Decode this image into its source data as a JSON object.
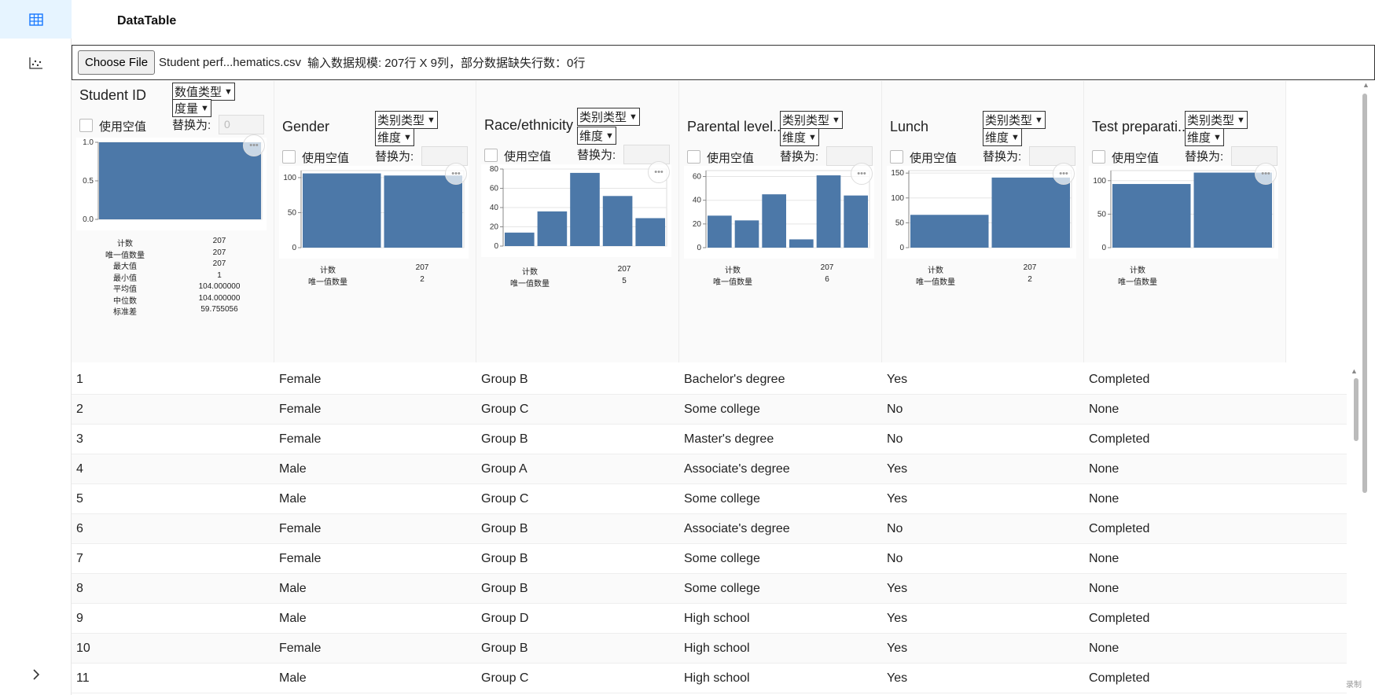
{
  "app": {
    "title": "DataTable"
  },
  "nav": {
    "items": [
      {
        "icon": "table-icon"
      },
      {
        "icon": "scatter-chart-icon"
      }
    ],
    "expand_icon": "chevron-right-icon"
  },
  "upload": {
    "button_label": "Choose File",
    "file_name": "Student perf...hematics.csv",
    "scale_text": "输入数据规模: 207行 X 9列，部分数据缺失行数：0行"
  },
  "columns": [
    {
      "name": "Student ID",
      "type_select": "数值类型",
      "role_select": "度量",
      "use_null_label": "使用空值",
      "replace_label": "替换为:",
      "replace_placeholder": "0",
      "stats": [
        [
          "计数",
          "207"
        ],
        [
          "唯一值数量",
          "207"
        ],
        [
          "最大值",
          "207"
        ],
        [
          "最小值",
          "1"
        ],
        [
          "平均值",
          "104.000000"
        ],
        [
          "中位数",
          "104.000000"
        ],
        [
          "标准差",
          "59.755056"
        ]
      ]
    },
    {
      "name": "Gender",
      "type_select": "类别类型",
      "role_select": "维度",
      "use_null_label": "使用空值",
      "replace_label": "替换为:",
      "replace_placeholder": "",
      "stats": [
        [
          "计数",
          "207"
        ],
        [
          "唯一值数量",
          "2"
        ]
      ]
    },
    {
      "name": "Race/ethnicity",
      "type_select": "类别类型",
      "role_select": "维度",
      "use_null_label": "使用空值",
      "replace_label": "替换为:",
      "replace_placeholder": "",
      "stats": [
        [
          "计数",
          "207"
        ],
        [
          "唯一值数量",
          "5"
        ]
      ]
    },
    {
      "name": "Parental level...",
      "type_select": "类别类型",
      "role_select": "维度",
      "use_null_label": "使用空值",
      "replace_label": "替换为:",
      "replace_placeholder": "",
      "stats": [
        [
          "计数",
          "207"
        ],
        [
          "唯一值数量",
          "6"
        ]
      ]
    },
    {
      "name": "Lunch",
      "type_select": "类别类型",
      "role_select": "维度",
      "use_null_label": "使用空值",
      "replace_label": "替换为:",
      "replace_placeholder": "",
      "stats": [
        [
          "计数",
          "207"
        ],
        [
          "唯一值数量",
          "2"
        ]
      ]
    },
    {
      "name": "Test preparati...",
      "type_select": "类别类型",
      "role_select": "维度",
      "use_null_label": "使用空值",
      "replace_label": "替换为:",
      "replace_placeholder": "",
      "stats": [
        [
          "计数",
          ""
        ],
        [
          "唯一值数量",
          ""
        ]
      ]
    }
  ],
  "chart_data": [
    {
      "type": "area",
      "yticks": [
        "1.0",
        "0.5",
        "0.0"
      ],
      "ylim": [
        0,
        1
      ],
      "values": [
        1,
        1
      ]
    },
    {
      "type": "bar",
      "yticks": [
        "100",
        "50",
        "0"
      ],
      "ylim": [
        0,
        110
      ],
      "values": [
        106,
        103
      ]
    },
    {
      "type": "bar",
      "yticks": [
        "80",
        "60",
        "40",
        "20",
        "0"
      ],
      "ylim": [
        0,
        80
      ],
      "values": [
        14,
        36,
        76,
        52,
        29
      ]
    },
    {
      "type": "bar",
      "yticks": [
        "60",
        "40",
        "20",
        "0"
      ],
      "ylim": [
        0,
        65
      ],
      "values": [
        27,
        23,
        45,
        7,
        61,
        44
      ]
    },
    {
      "type": "bar",
      "yticks": [
        "150",
        "100",
        "50",
        "0"
      ],
      "ylim": [
        0,
        155
      ],
      "values": [
        66,
        141
      ]
    },
    {
      "type": "bar",
      "yticks": [
        "100",
        "50",
        "0"
      ],
      "ylim": [
        0,
        115
      ],
      "values": [
        95,
        112
      ]
    }
  ],
  "rows": [
    [
      "1",
      "Female",
      "Group B",
      "Bachelor's degree",
      "Yes",
      "Completed"
    ],
    [
      "2",
      "Female",
      "Group C",
      "Some college",
      "No",
      "None"
    ],
    [
      "3",
      "Female",
      "Group B",
      "Master's degree",
      "No",
      "Completed"
    ],
    [
      "4",
      "Male",
      "Group A",
      "Associate's degree",
      "Yes",
      "None"
    ],
    [
      "5",
      "Male",
      "Group C",
      "Some college",
      "Yes",
      "None"
    ],
    [
      "6",
      "Female",
      "Group B",
      "Associate's degree",
      "No",
      "Completed"
    ],
    [
      "7",
      "Female",
      "Group B",
      "Some college",
      "No",
      "None"
    ],
    [
      "8",
      "Male",
      "Group B",
      "Some college",
      "Yes",
      "None"
    ],
    [
      "9",
      "Male",
      "Group D",
      "High school",
      "Yes",
      "Completed"
    ],
    [
      "10",
      "Female",
      "Group B",
      "High school",
      "Yes",
      "None"
    ],
    [
      "11",
      "Male",
      "Group C",
      "High school",
      "Yes",
      "Completed"
    ]
  ],
  "colors": {
    "bar": "#4c78a8",
    "nav_active": "#e6f4ff",
    "nav_icon": "#1677ff"
  },
  "watermark": "录制"
}
